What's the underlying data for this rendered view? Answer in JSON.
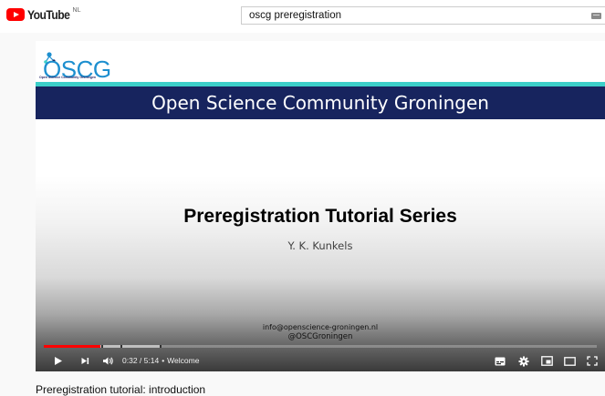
{
  "header": {
    "logo_text": "YouTube",
    "region_code": "NL",
    "search_value": "oscg preregistration",
    "icons": [
      "youtube-logo-icon",
      "keyboard-icon"
    ]
  },
  "slide": {
    "logo_text": "OSCG",
    "logo_subtext": "Open Science Community Groningen",
    "banner": "Open Science Community Groningen",
    "title": "Preregistration Tutorial Series",
    "author": "Y. K. Kunkels",
    "email": "info@openscience-groningen.nl",
    "handle": "@OSCGroningen",
    "colors": {
      "banner": "#17245e",
      "accent": "#3ccfc9"
    }
  },
  "player": {
    "current_time": "0:32",
    "duration": "5:14",
    "separator": "•",
    "chapter": "Welcome",
    "played_fraction": 0.102,
    "loaded_fraction": 0.21,
    "progress_color": "#ff0000",
    "icons": [
      "play-icon",
      "next-icon",
      "volume-icon",
      "subtitles-icon",
      "settings-icon",
      "miniplayer-icon",
      "theater-icon",
      "fullscreen-icon"
    ]
  },
  "video_title": "Preregistration tutorial: introduction"
}
